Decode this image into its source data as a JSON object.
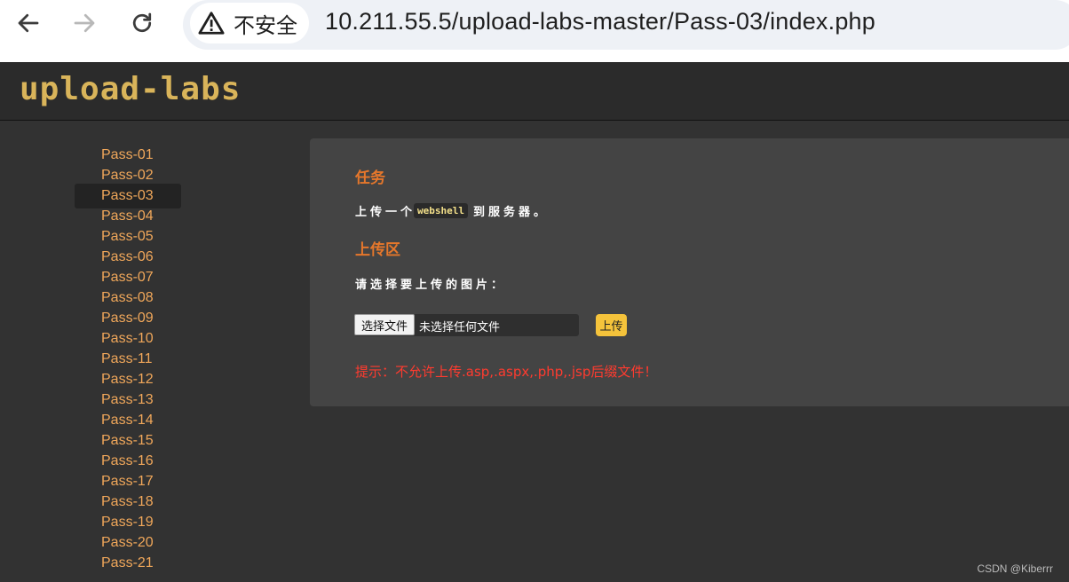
{
  "browser": {
    "security_label": "不安全",
    "url": "10.211.55.5/upload-labs-master/Pass-03/index.php"
  },
  "site": {
    "logo_text": "upload-labs"
  },
  "sidebar": {
    "items": [
      "Pass-01",
      "Pass-02",
      "Pass-03",
      "Pass-04",
      "Pass-05",
      "Pass-06",
      "Pass-07",
      "Pass-08",
      "Pass-09",
      "Pass-10",
      "Pass-11",
      "Pass-12",
      "Pass-13",
      "Pass-14",
      "Pass-15",
      "Pass-16",
      "Pass-17",
      "Pass-18",
      "Pass-19",
      "Pass-20",
      "Pass-21"
    ],
    "active": "Pass-03"
  },
  "task": {
    "title": "任务",
    "text_before": "上传一个",
    "code": "webshell",
    "text_after": "到服务器。"
  },
  "upload": {
    "title": "上传区",
    "choose_label": "请选择要上传的图片：",
    "file_button": "选择文件",
    "file_status": "未选择任何文件",
    "submit_label": "上传",
    "hint": "提示：不允许上传.asp,.aspx,.php,.jsp后缀文件！"
  },
  "watermark": "CSDN @Kiberrr",
  "colors": {
    "accent": "#e6772b",
    "nav_link": "#f0a75a",
    "hint": "#ff3b2f",
    "button": "#f5c33b"
  }
}
